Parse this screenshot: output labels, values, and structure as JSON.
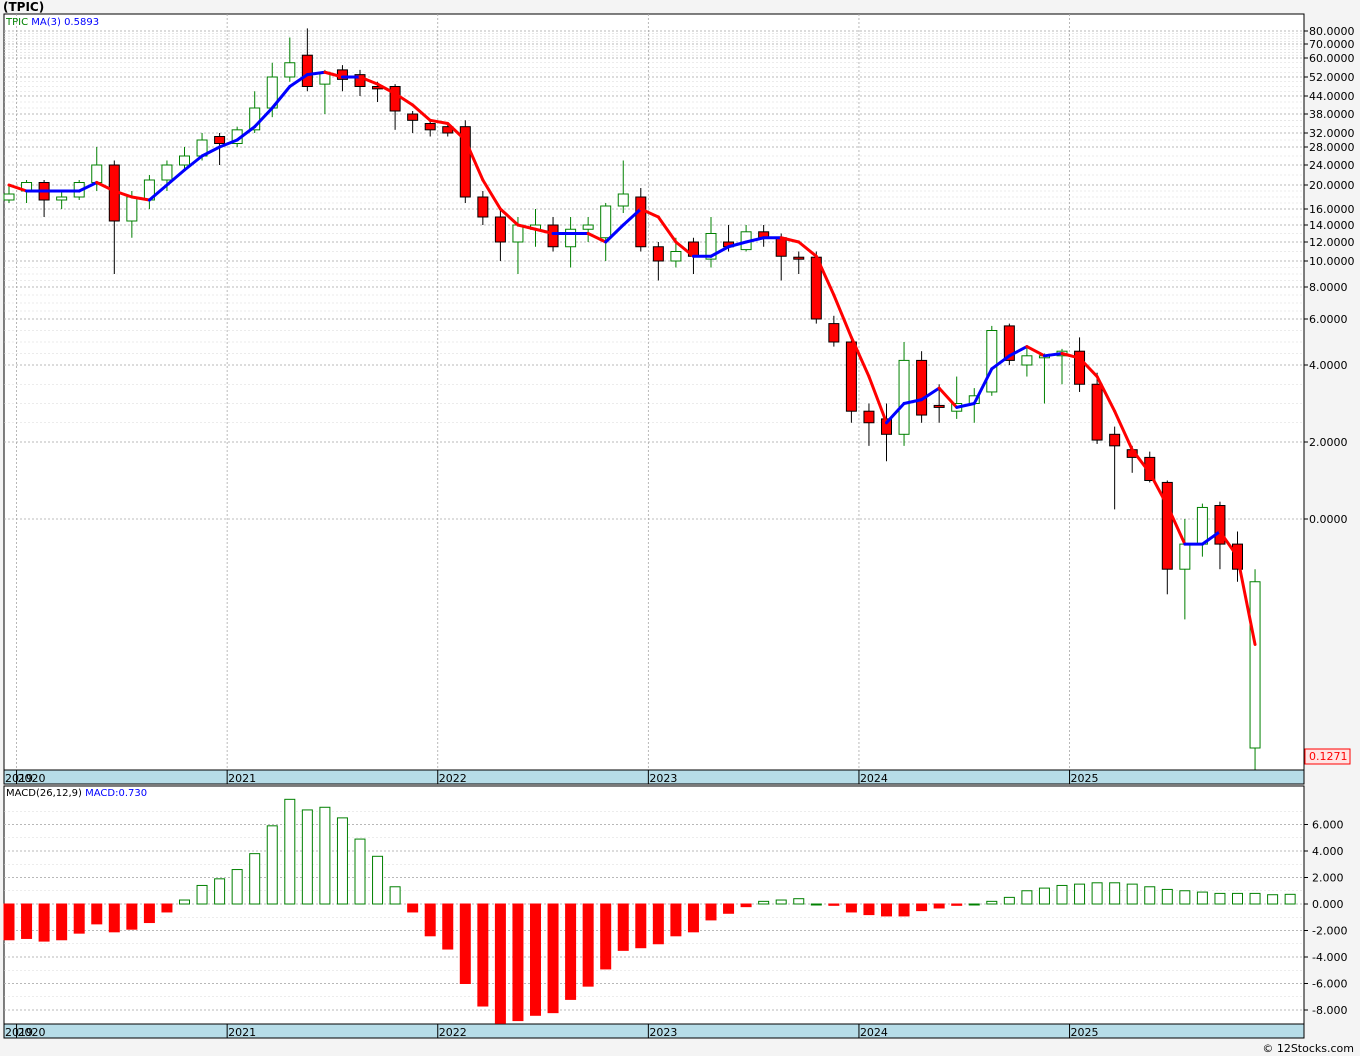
{
  "title": "(TPIC)",
  "legend_price": {
    "ticker": "TPIC",
    "ma_label": "MA(3)",
    "ma_value": "0.5893"
  },
  "legend_macd": {
    "label": "MACD(26,12,9)",
    "value": "MACD:0.730"
  },
  "last_price_label": "0.1271",
  "copyright": "© 12Stocks.com",
  "colors": {
    "up": "#008000",
    "down": "#ff0000",
    "ma_up": "#0000ff",
    "ma_down": "#ff0000",
    "axis_band": "#b7dde8"
  },
  "chart_data": [
    {
      "type": "candlestick",
      "title": "",
      "y_scale": "custom-log",
      "ylim": [
        0.1271,
        80
      ],
      "y_ticks": [
        "80.0000",
        "70.0000",
        "60.0000",
        "52.0000",
        "44.0000",
        "38.0000",
        "32.0000",
        "28.0000",
        "24.0000",
        "20.0000",
        "16.0000",
        "14.0000",
        "12.0000",
        "10.0000",
        "8.0000",
        "6.0000",
        "4.0000",
        "2.0000",
        "0.0000"
      ],
      "x_ticks": [
        "2019",
        "2020",
        "2021",
        "2022",
        "2023",
        "2024",
        "2025"
      ],
      "grid": true,
      "candles": [
        {
          "date": "2019-12",
          "o": 17.5,
          "h": 20,
          "l": 17,
          "c": 18.5
        },
        {
          "date": "2020-01",
          "o": 19,
          "h": 21,
          "l": 17,
          "c": 20.5
        },
        {
          "date": "2020-02",
          "o": 20.5,
          "h": 21,
          "l": 15,
          "c": 17.5
        },
        {
          "date": "2020-03",
          "o": 17.5,
          "h": 19,
          "l": 16,
          "c": 18
        },
        {
          "date": "2020-04",
          "o": 18,
          "h": 21,
          "l": 17.5,
          "c": 20.5
        },
        {
          "date": "2020-05",
          "o": 20.5,
          "h": 28,
          "l": 19,
          "c": 24
        },
        {
          "date": "2020-06",
          "o": 24,
          "h": 25,
          "l": 9,
          "c": 14.5
        },
        {
          "date": "2020-07",
          "o": 14.5,
          "h": 19,
          "l": 12.5,
          "c": 18
        },
        {
          "date": "2020-08",
          "o": 17.5,
          "h": 22,
          "l": 16,
          "c": 21
        },
        {
          "date": "2020-09",
          "o": 21,
          "h": 25,
          "l": 19,
          "c": 24
        },
        {
          "date": "2020-10",
          "o": 24,
          "h": 28,
          "l": 23,
          "c": 26
        },
        {
          "date": "2020-11",
          "o": 26,
          "h": 32,
          "l": 25,
          "c": 30
        },
        {
          "date": "2020-12",
          "o": 31,
          "h": 32,
          "l": 24,
          "c": 29
        },
        {
          "date": "2021-01",
          "o": 29,
          "h": 34,
          "l": 28,
          "c": 33
        },
        {
          "date": "2021-02",
          "o": 33,
          "h": 46,
          "l": 32,
          "c": 40
        },
        {
          "date": "2021-03",
          "o": 40,
          "h": 58,
          "l": 37,
          "c": 52
        },
        {
          "date": "2021-04",
          "o": 52,
          "h": 75,
          "l": 50,
          "c": 58
        },
        {
          "date": "2021-05",
          "o": 62,
          "h": 82,
          "l": 46,
          "c": 48
        },
        {
          "date": "2021-06",
          "o": 49,
          "h": 55,
          "l": 38,
          "c": 54
        },
        {
          "date": "2021-07",
          "o": 55,
          "h": 57,
          "l": 46,
          "c": 51
        },
        {
          "date": "2021-08",
          "o": 53,
          "h": 55,
          "l": 44,
          "c": 48
        },
        {
          "date": "2021-09",
          "o": 48,
          "h": 50,
          "l": 42,
          "c": 47
        },
        {
          "date": "2021-10",
          "o": 48,
          "h": 49,
          "l": 33,
          "c": 39
        },
        {
          "date": "2021-11",
          "o": 38,
          "h": 39,
          "l": 32,
          "c": 36
        },
        {
          "date": "2021-12",
          "o": 35,
          "h": 36,
          "l": 31,
          "c": 33
        },
        {
          "date": "2022-01",
          "o": 34,
          "h": 35,
          "l": 31,
          "c": 32
        },
        {
          "date": "2022-02",
          "o": 34,
          "h": 36,
          "l": 17,
          "c": 18
        },
        {
          "date": "2022-03",
          "o": 18,
          "h": 19,
          "l": 14,
          "c": 15
        },
        {
          "date": "2022-04",
          "o": 15,
          "h": 16,
          "l": 10,
          "c": 12
        },
        {
          "date": "2022-05",
          "o": 12,
          "h": 15,
          "l": 9,
          "c": 14
        },
        {
          "date": "2022-06",
          "o": 13.5,
          "h": 16,
          "l": 11.5,
          "c": 14
        },
        {
          "date": "2022-07",
          "o": 14,
          "h": 15,
          "l": 11,
          "c": 11.5
        },
        {
          "date": "2022-08",
          "o": 11.5,
          "h": 15,
          "l": 9.5,
          "c": 13.5
        },
        {
          "date": "2022-09",
          "o": 13.5,
          "h": 15,
          "l": 12,
          "c": 14
        },
        {
          "date": "2022-10",
          "o": 12.5,
          "h": 17,
          "l": 10,
          "c": 16.5
        },
        {
          "date": "2022-11",
          "o": 16.5,
          "h": 25,
          "l": 15.5,
          "c": 18.5
        },
        {
          "date": "2022-12",
          "o": 18,
          "h": 19.5,
          "l": 11,
          "c": 11.5
        },
        {
          "date": "2023-01",
          "o": 11.5,
          "h": 12,
          "l": 8.5,
          "c": 10
        },
        {
          "date": "2023-02",
          "o": 10,
          "h": 12.5,
          "l": 9.5,
          "c": 11
        },
        {
          "date": "2023-03",
          "o": 12,
          "h": 12.5,
          "l": 9,
          "c": 10.5
        },
        {
          "date": "2023-04",
          "o": 10.2,
          "h": 15,
          "l": 9.5,
          "c": 13
        },
        {
          "date": "2023-05",
          "o": 12,
          "h": 14,
          "l": 11,
          "c": 11.5
        },
        {
          "date": "2023-06",
          "o": 11.2,
          "h": 14,
          "l": 11,
          "c": 13.2
        },
        {
          "date": "2023-07",
          "o": 13.2,
          "h": 14,
          "l": 11.5,
          "c": 12.5
        },
        {
          "date": "2023-08",
          "o": 12.5,
          "h": 13,
          "l": 8.5,
          "c": 10.5
        },
        {
          "date": "2023-09",
          "o": 10.4,
          "h": 11,
          "l": 9,
          "c": 10.2
        },
        {
          "date": "2023-10",
          "o": 10.4,
          "h": 11,
          "l": 5.8,
          "c": 6.0
        },
        {
          "date": "2023-11",
          "o": 5.8,
          "h": 6.2,
          "l": 4.8,
          "c": 5.0
        },
        {
          "date": "2023-12",
          "o": 5.0,
          "h": 5.2,
          "l": 2.5,
          "c": 2.8
        },
        {
          "date": "2024-01",
          "o": 2.8,
          "h": 3.0,
          "l": 1.9,
          "c": 2.5
        },
        {
          "date": "2024-02",
          "o": 2.6,
          "h": 3.0,
          "l": 1.5,
          "c": 2.2
        },
        {
          "date": "2024-03",
          "o": 2.2,
          "h": 5.0,
          "l": 1.9,
          "c": 4.2
        },
        {
          "date": "2024-04",
          "o": 4.2,
          "h": 4.6,
          "l": 2.5,
          "c": 2.7
        },
        {
          "date": "2024-05",
          "o": 2.95,
          "h": 3.5,
          "l": 2.5,
          "c": 2.9
        },
        {
          "date": "2024-06",
          "o": 2.8,
          "h": 3.7,
          "l": 2.6,
          "c": 3.0
        },
        {
          "date": "2024-07",
          "o": 3.0,
          "h": 3.4,
          "l": 2.5,
          "c": 3.2
        },
        {
          "date": "2024-08",
          "o": 3.3,
          "h": 5.7,
          "l": 3.2,
          "c": 5.5
        },
        {
          "date": "2024-09",
          "o": 5.7,
          "h": 5.8,
          "l": 4.0,
          "c": 4.2
        },
        {
          "date": "2024-10",
          "o": 4.0,
          "h": 4.8,
          "l": 3.7,
          "c": 4.4
        },
        {
          "date": "2024-11",
          "o": 4.4,
          "h": 4.5,
          "l": 3.0,
          "c": 4.4
        },
        {
          "date": "2024-12",
          "o": 4.4,
          "h": 4.7,
          "l": 3.5,
          "c": 4.6
        },
        {
          "date": "2025-01",
          "o": 4.6,
          "h": 5.2,
          "l": 3.3,
          "c": 3.5
        },
        {
          "date": "2025-02",
          "o": 3.5,
          "h": 3.8,
          "l": 1.95,
          "c": 2.05
        },
        {
          "date": "2025-03",
          "o": 2.2,
          "h": 2.4,
          "l": 0.25,
          "c": 1.9
        },
        {
          "date": "2025-04",
          "o": 1.8,
          "h": 1.9,
          "l": 1.2,
          "c": 1.6
        },
        {
          "date": "2025-05",
          "o": 1.6,
          "h": 1.75,
          "l": 0.95,
          "c": 1.0
        },
        {
          "date": "2025-06",
          "o": 0.95,
          "h": 1.0,
          "l": -0.3,
          "c": -0.2
        },
        {
          "date": "2025-07",
          "o": -0.2,
          "h": 0.0,
          "l": -0.4,
          "c": -0.1
        },
        {
          "date": "2025-08",
          "o": -0.1,
          "h": 0.4,
          "l": -0.15,
          "c": 0.3
        },
        {
          "date": "2025-09",
          "o": 0.35,
          "h": 0.45,
          "l": -0.2,
          "c": -0.1
        },
        {
          "date": "2025-10",
          "o": -0.1,
          "h": -0.05,
          "l": -0.25,
          "c": -0.2
        },
        {
          "date": "2025-11",
          "o": -0.25,
          "h": -0.2,
          "l": 0.1271,
          "c": 0.1271
        }
      ],
      "ma3": [
        20,
        19,
        19,
        19,
        19,
        20.5,
        19,
        18,
        17.5,
        20,
        23,
        26,
        28,
        30,
        34,
        40,
        48,
        53,
        54,
        52,
        52,
        49,
        45,
        41,
        36,
        35,
        30,
        21,
        16,
        14,
        13.5,
        13,
        13,
        13,
        12,
        14,
        16,
        15,
        12,
        10.5,
        10.5,
        11.5,
        12,
        12.5,
        12.5,
        12,
        10.5,
        7.5,
        5.2,
        3.7,
        2.5,
        3,
        3.1,
        3.4,
        2.9,
        3,
        3.9,
        4.4,
        4.8,
        4.4,
        4.5,
        4.3,
        3.7,
        2.8,
        1.8,
        1.2,
        0.35,
        -0.1,
        -0.1,
        -0.05,
        -0.15,
        -0.5
      ]
    },
    {
      "type": "bar",
      "title": "",
      "ylim": [
        -9,
        8
      ],
      "y_ticks": [
        "6.000",
        "4.000",
        "2.000",
        "0.000",
        "-2.000",
        "-4.000",
        "-6.000",
        "-8.000"
      ],
      "x_ticks": [
        "2019",
        "2020",
        "2021",
        "2022",
        "2023",
        "2024",
        "2025"
      ],
      "values": [
        -2.7,
        -2.6,
        -2.8,
        -2.7,
        -2.2,
        -1.5,
        -2.1,
        -1.9,
        -1.4,
        -0.6,
        0.3,
        1.4,
        1.9,
        2.6,
        3.8,
        5.9,
        7.9,
        7.1,
        7.3,
        6.5,
        4.9,
        3.6,
        1.3,
        -0.6,
        -2.4,
        -3.4,
        -6.0,
        -7.7,
        -9.0,
        -8.8,
        -8.4,
        -8.2,
        -7.2,
        -6.2,
        -4.9,
        -3.5,
        -3.3,
        -3.0,
        -2.4,
        -2.1,
        -1.2,
        -0.7,
        -0.2,
        0.2,
        0.3,
        0.4,
        0,
        -0.1,
        -0.6,
        -0.8,
        -0.9,
        -0.9,
        -0.5,
        -0.3,
        -0.1,
        0,
        0.2,
        0.5,
        1.0,
        1.2,
        1.4,
        1.5,
        1.6,
        1.6,
        1.5,
        1.3,
        1.1,
        1.0,
        0.9,
        0.8,
        0.8,
        0.8,
        0.7,
        0.73
      ]
    }
  ]
}
